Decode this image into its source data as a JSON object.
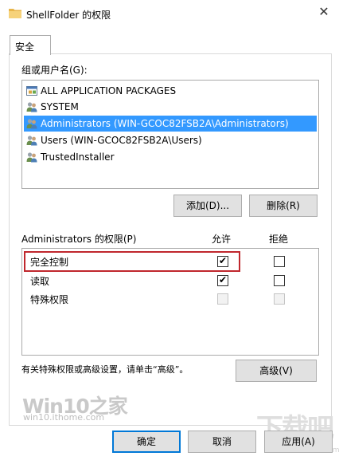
{
  "window": {
    "title": "ShellFolder 的权限",
    "close_glyph": "✕"
  },
  "tabs": [
    {
      "label": "安全"
    }
  ],
  "group_list": {
    "label": "组或用户名(G):",
    "items": [
      {
        "label": "ALL APPLICATION PACKAGES",
        "icon": "app-packages-icon",
        "selected": false
      },
      {
        "label": "SYSTEM",
        "icon": "user-group-icon",
        "selected": false
      },
      {
        "label": "Administrators (WIN-GCOC82FSB2A\\Administrators)",
        "icon": "user-group-icon",
        "selected": true
      },
      {
        "label": "Users (WIN-GCOC82FSB2A\\Users)",
        "icon": "user-group-icon",
        "selected": false
      },
      {
        "label": "TrustedInstaller",
        "icon": "user-group-icon",
        "selected": false
      }
    ]
  },
  "buttons": {
    "add": "添加(D)...",
    "remove": "删除(R)",
    "advanced": "高级(V)",
    "ok": "确定",
    "cancel": "取消",
    "apply": "应用(A)"
  },
  "permissions": {
    "label": "Administrators 的权限(P)",
    "allow_header": "允许",
    "deny_header": "拒绝",
    "rows": [
      {
        "name": "完全控制",
        "allow": true,
        "deny": false,
        "enabled": true,
        "highlighted": true
      },
      {
        "name": "读取",
        "allow": true,
        "deny": false,
        "enabled": true,
        "highlighted": false
      },
      {
        "name": "特殊权限",
        "allow": false,
        "deny": false,
        "enabled": false,
        "highlighted": false
      }
    ]
  },
  "advanced_hint": "有关特殊权限或高级设置，请单击“高级”。",
  "watermarks": {
    "left_logo": "Win10之家",
    "left_url": "win10.ithome.com",
    "right_logo": "下载吧",
    "right_url": "www.xiazaiba.com"
  },
  "colors": {
    "selection": "#3399ff",
    "highlight_border": "#c0272d",
    "button_face": "#e1e1e1",
    "default_button_border": "#0078d7"
  }
}
